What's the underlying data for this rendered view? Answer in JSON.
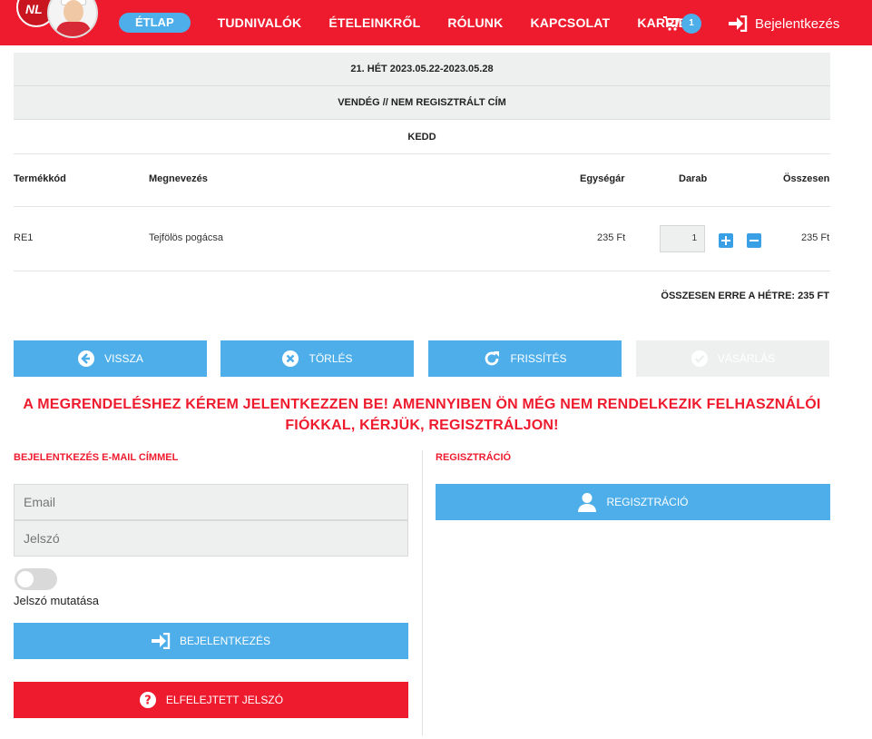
{
  "nav": {
    "logo_text": "NL",
    "items": [
      {
        "label": "ÉTLAP",
        "active": true
      },
      {
        "label": "TUDNIVALÓK"
      },
      {
        "label": "ÉTELEINKRŐL"
      },
      {
        "label": "RÓLUNK"
      },
      {
        "label": "KAPCSOLAT"
      },
      {
        "label": "KARRIER"
      }
    ],
    "cart_count": "1",
    "login_label": "Bejelentkezés"
  },
  "order": {
    "week": "21. HÉT 2023.05.22-2023.05.28",
    "customer": "VENDÉG // NEM REGISZTRÁLT CÍM",
    "day": "KEDD"
  },
  "table": {
    "headers": {
      "code": "Termékkód",
      "name": "Megnevezés",
      "unit_price": "Egységár",
      "qty": "Darab",
      "total": "Összesen"
    },
    "rows": [
      {
        "code": "RE1",
        "name": "Tejfölös pogácsa",
        "unit_price": "235 Ft",
        "qty": "1",
        "total": "235 Ft"
      }
    ],
    "week_total": "ÖSSZESEN ERRE A HÉTRE: 235 FT"
  },
  "actions": {
    "back": "VISSZA",
    "delete": "TÖRLÉS",
    "refresh": "FRISSÍTÉS",
    "purchase": "VÁSÁRLÁS"
  },
  "warning": "A MEGRENDELÉSHEZ KÉREM JELENTKEZZEN BE! AMENNYIBEN ÖN MÉG NEM RENDELKEZIK FELHASZNÁLÓI FIÓKKAL, KÉRJÜK, REGISZTRÁLJON!",
  "login": {
    "title": "BEJELENTKEZÉS E-MAIL CÍMMEL",
    "email_placeholder": "Email",
    "password_placeholder": "Jelszó",
    "show_password": "Jelszó mutatása",
    "login_button": "BEJELENTKEZÉS",
    "forgot_button": "ELFELEJTETT JELSZÓ"
  },
  "register": {
    "title": "REGISZTRÁCIÓ",
    "button": "REGISZTRÁCIÓ"
  },
  "colors": {
    "brand_red": "#ee1b2e",
    "accent_blue": "#4daeea",
    "light_gray": "#eef0f0"
  }
}
